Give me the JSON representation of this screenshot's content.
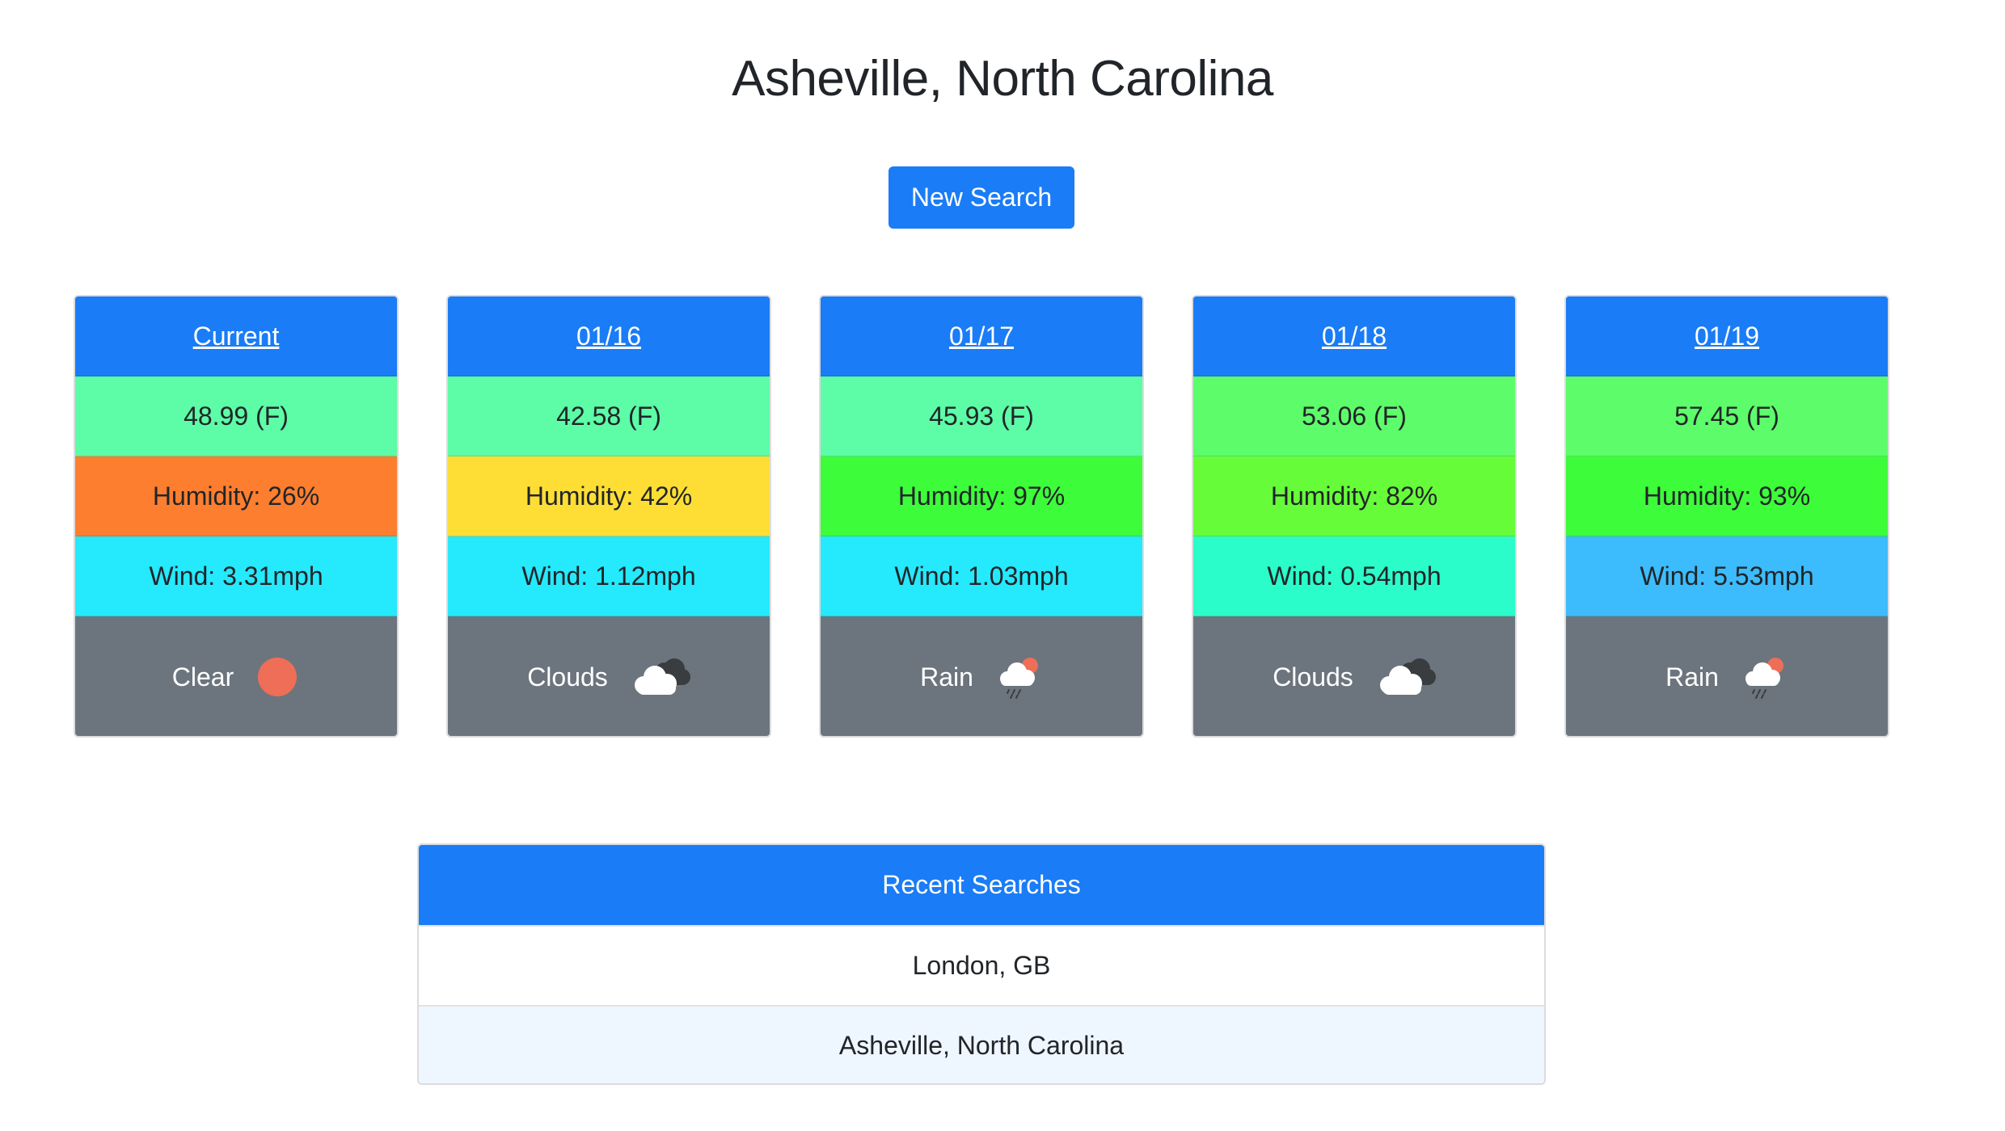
{
  "page": {
    "title": "Asheville, North Carolina",
    "new_search_label": "New Search"
  },
  "colors": {
    "primary": "#1a7cf6",
    "condition_bg": "#6c757d"
  },
  "forecast": [
    {
      "date": "Current",
      "temp": "48.99 (F)",
      "temp_color": "#5dfca6",
      "humidity": "Humidity: 26%",
      "humidity_color": "#fd7e2f",
      "wind": "Wind: 3.31mph",
      "wind_color": "#25e9fc",
      "condition": "Clear",
      "icon": "sun-icon"
    },
    {
      "date": "01/16",
      "temp": "42.58 (F)",
      "temp_color": "#5dfca6",
      "humidity": "Humidity: 42%",
      "humidity_color": "#fede35",
      "wind": "Wind: 1.12mph",
      "wind_color": "#25e9fc",
      "condition": "Clouds",
      "icon": "cloud-icon"
    },
    {
      "date": "01/17",
      "temp": "45.93 (F)",
      "temp_color": "#5dfca6",
      "humidity": "Humidity: 97%",
      "humidity_color": "#3dfc3a",
      "wind": "Wind: 1.03mph",
      "wind_color": "#25e9fc",
      "condition": "Rain",
      "icon": "rain-icon"
    },
    {
      "date": "01/18",
      "temp": "53.06 (F)",
      "temp_color": "#5dfc6a",
      "humidity": "Humidity: 82%",
      "humidity_color": "#67fc3a",
      "wind": "Wind: 0.54mph",
      "wind_color": "#2afcca",
      "condition": "Clouds",
      "icon": "cloud-icon"
    },
    {
      "date": "01/19",
      "temp": "57.45 (F)",
      "temp_color": "#5dfc6a",
      "humidity": "Humidity: 93%",
      "humidity_color": "#3dfc3a",
      "wind": "Wind: 5.53mph",
      "wind_color": "#3cbcfc",
      "condition": "Rain",
      "icon": "rain-icon"
    }
  ],
  "recent": {
    "header": "Recent Searches",
    "items": [
      "London, GB",
      "Asheville, North Carolina"
    ]
  }
}
